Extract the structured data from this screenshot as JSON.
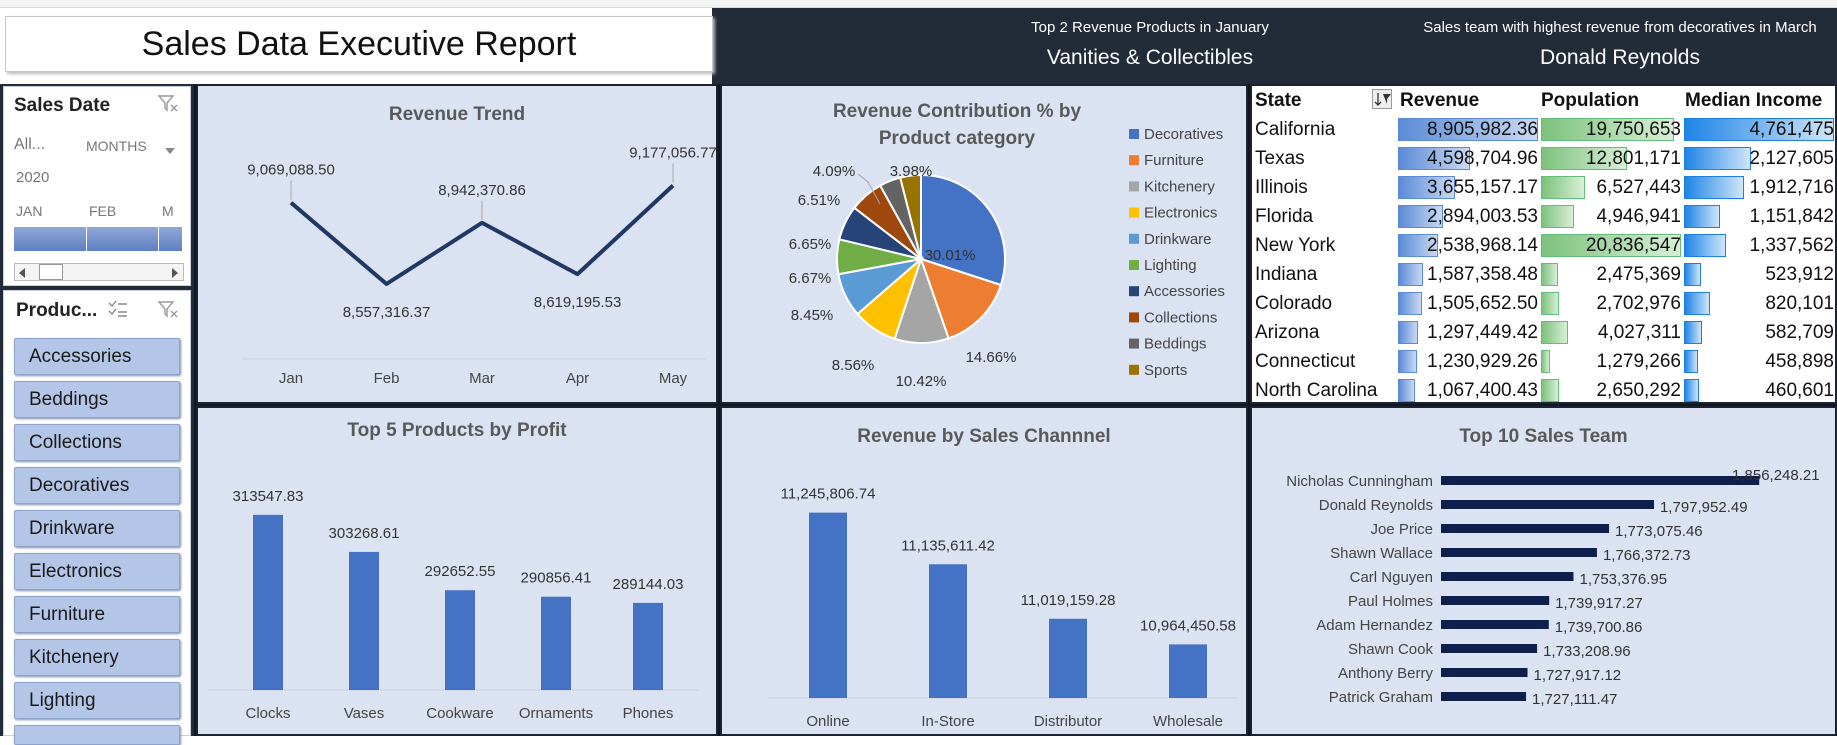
{
  "report_title": "Sales Data Executive Report",
  "kpi": [
    {
      "label": "Top 2 Revenue Products in  January",
      "value": "Vanities & Collectibles"
    },
    {
      "label": "Sales team with highest revenue from decoratives in March",
      "value": "Donald Reynolds"
    }
  ],
  "date_slicer": {
    "title": "Sales Date",
    "period_label": "All...",
    "level_label": "MONTHS",
    "year": "2020",
    "months": [
      "JAN",
      "FEB",
      "M"
    ]
  },
  "product_slicer": {
    "title": "Produc...",
    "items": [
      "Accessories",
      "Beddings",
      "Collections",
      "Decoratives",
      "Drinkware",
      "Electronics",
      "Furniture",
      "Kitchenery",
      "Lighting"
    ]
  },
  "colors": {
    "dark": "#222b38",
    "panel": "#dbe2f2",
    "bar": "#4472c4",
    "line": "#203864",
    "navy": "#0f1f4b"
  },
  "icons": {
    "filter_clear": "filter-clear-icon",
    "multiselect": "multi-select-icon",
    "dropdown": "chevron-down-icon",
    "scroll_left": "scroll-left-icon",
    "scroll_right": "scroll-right-icon",
    "sort": "sort-filter-icon"
  },
  "state_table": {
    "headers": [
      "State",
      "Revenue",
      "Population",
      "Median Income"
    ],
    "rows": [
      {
        "state": "California",
        "revenue": "8,905,982.36",
        "population": "19,750,653",
        "income": "4,761,475"
      },
      {
        "state": "Texas",
        "revenue": "4,598,704.96",
        "population": "12,801,171",
        "income": "2,127,605"
      },
      {
        "state": "Illinois",
        "revenue": "3,655,157.17",
        "population": "6,527,443",
        "income": "1,912,716"
      },
      {
        "state": "Florida",
        "revenue": "2,894,003.53",
        "population": "4,946,941",
        "income": "1,151,842"
      },
      {
        "state": "New York",
        "revenue": "2,538,968.14",
        "population": "20,836,547",
        "income": "1,337,562"
      },
      {
        "state": "Indiana",
        "revenue": "1,587,358.48",
        "population": "2,475,369",
        "income": "523,912"
      },
      {
        "state": "Colorado",
        "revenue": "1,505,652.50",
        "population": "2,702,976",
        "income": "820,101"
      },
      {
        "state": "Arizona",
        "revenue": "1,297,449.42",
        "population": "4,027,311",
        "income": "582,709"
      },
      {
        "state": "Connecticut",
        "revenue": "1,230,929.26",
        "population": "1,279,266",
        "income": "458,898"
      },
      {
        "state": "North Carolina",
        "revenue": "1,067,400.43",
        "population": "2,650,292",
        "income": "460,601"
      }
    ]
  },
  "chart_data": [
    {
      "type": "line",
      "title": "Revenue Trend",
      "categories": [
        "Jan",
        "Feb",
        "Mar",
        "Apr",
        "May"
      ],
      "values": [
        9069088.5,
        8557316.37,
        8942370.86,
        8619195.53,
        9177056.77
      ],
      "data_labels": [
        "9,069,088.50",
        "8,557,316.37",
        "8,942,370.86",
        "8,619,195.53",
        "9,177,056.77"
      ],
      "ylim": [
        8450000,
        9300000
      ],
      "grid": false
    },
    {
      "type": "pie",
      "title": "Revenue Contribution % by Product category",
      "legend_position": "right",
      "series": [
        {
          "name": "Decoratives",
          "value": 30.01,
          "label": "30.01%",
          "color": "#4472c4"
        },
        {
          "name": "Furniture",
          "value": 14.66,
          "label": "14.66%",
          "color": "#ed7d31"
        },
        {
          "name": "Kitchenery",
          "value": 10.42,
          "label": "10.42%",
          "color": "#a5a5a5"
        },
        {
          "name": "Electronics",
          "value": 8.56,
          "label": "8.56%",
          "color": "#ffc000"
        },
        {
          "name": "Drinkware",
          "value": 8.45,
          "label": "8.45%",
          "color": "#5b9bd5"
        },
        {
          "name": "Lighting",
          "value": 6.67,
          "label": "6.67%",
          "color": "#70ad47"
        },
        {
          "name": "Accessories",
          "value": 6.65,
          "label": "6.65%",
          "color": "#264478"
        },
        {
          "name": "Collections",
          "value": 6.51,
          "label": "6.51%",
          "color": "#9e480e"
        },
        {
          "name": "Beddings",
          "value": 4.09,
          "label": "4.09%",
          "color": "#636363"
        },
        {
          "name": "Sports",
          "value": 3.98,
          "label": "3.98%",
          "color": "#997300"
        }
      ]
    },
    {
      "type": "bar",
      "title": "Top 5 Products by Profit",
      "categories": [
        "Clocks",
        "Vases",
        "Cookware",
        "Ornaments",
        "Phones"
      ],
      "values": [
        313547.83,
        303268.61,
        292652.55,
        290856.41,
        289144.03
      ],
      "data_labels": [
        "313547.83",
        "303268.61",
        "292652.55",
        "290856.41",
        "289144.03"
      ],
      "ylim": [
        265000,
        316000
      ]
    },
    {
      "type": "bar",
      "title": "Revenue by Sales Channnel",
      "categories": [
        "Online",
        "In-Store",
        "Distributor",
        "Wholesale"
      ],
      "values": [
        11245806.74,
        11135611.42,
        11019159.28,
        10964450.58
      ],
      "data_labels": [
        "11,245,806.74",
        "11,135,611.42",
        "11,019,159.28",
        "10,964,450.58"
      ],
      "ylim": [
        10850000,
        11260000
      ]
    },
    {
      "type": "bar",
      "orientation": "horizontal",
      "title": "Top 10 Sales Team",
      "categories": [
        "Nicholas Cunningham",
        "Donald Reynolds",
        "Joe Price",
        "Shawn Wallace",
        "Carl Nguyen",
        "Paul Holmes",
        "Adam Hernandez",
        "Shawn Cook",
        "Anthony Berry",
        "Patrick Graham"
      ],
      "values": [
        1856248.21,
        1797952.49,
        1773075.46,
        1766372.73,
        1753376.95,
        1739917.27,
        1739700.86,
        1733208.96,
        1727917.12,
        1727111.47
      ],
      "data_labels": [
        "1,856,248.21",
        "1,797,952.49",
        "1,773,075.46",
        "1,766,372.73",
        "1,753,376.95",
        "1,739,917.27",
        "1,739,700.86",
        "1,733,208.96",
        "1,727,917.12",
        "1,727,111.47"
      ],
      "xlim": [
        1680000,
        1860000
      ]
    }
  ]
}
